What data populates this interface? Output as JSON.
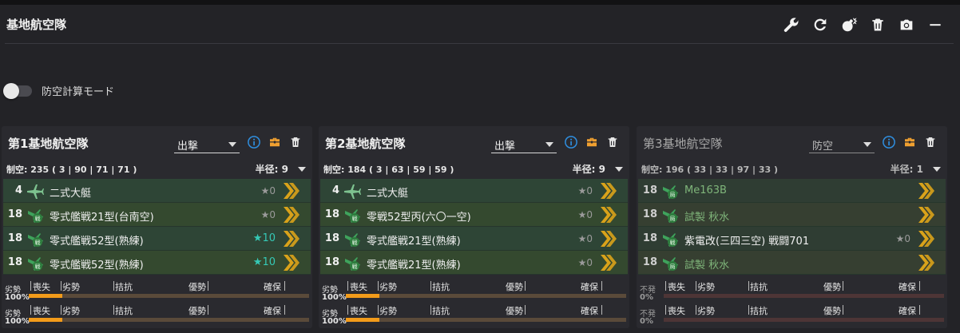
{
  "header": {
    "title": "基地航空隊"
  },
  "icons": {
    "wrench": "wrench-icon",
    "reload": "reload-icon",
    "bomb": "bomb-icon",
    "trash": "trash-icon",
    "camera": "camera-icon",
    "minimize": "minimize-icon"
  },
  "toggle": {
    "label": "防空計算モード",
    "on": false
  },
  "colors": {
    "accent_info": "#2f8fe0",
    "accent_orange": "#f0a030",
    "bar_fill": "#f29b1a",
    "chevron": "#d9a21a",
    "star_teal": "#35c9b6",
    "plane_green": "#3fa35c"
  },
  "corps": [
    {
      "name": "第1基地航空隊",
      "mode": "出撃",
      "air": "制空: 235 ( 3 | 90 | 71 | 71 )",
      "radius": "半径: 9",
      "slots": [
        {
          "count": "4",
          "name": "二式大艇",
          "prof": "★0",
          "prof_teal": false,
          "green": false,
          "icon": "flying-boat-icon"
        },
        {
          "count": "18",
          "name": "零式艦戦21型(台南空)",
          "prof": "★0",
          "prof_teal": false,
          "green": false,
          "icon": "fighter-icon"
        },
        {
          "count": "18",
          "name": "零式艦戦52型(熟練)",
          "prof": "★10",
          "prof_teal": true,
          "green": false,
          "icon": "fighter-icon"
        },
        {
          "count": "18",
          "name": "零式艦戦52型(熟練)",
          "prof": "★10",
          "prof_teal": true,
          "green": false,
          "icon": "fighter-icon"
        }
      ],
      "bars": [
        {
          "state": "劣勢",
          "pct": "100%",
          "fill": 0.12
        },
        {
          "state": "劣勢",
          "pct": "100%",
          "fill": 0.12
        }
      ]
    },
    {
      "name": "第2基地航空隊",
      "mode": "出撃",
      "air": "制空: 184 ( 3 | 63 | 59 | 59 )",
      "radius": "半径: 9",
      "slots": [
        {
          "count": "4",
          "name": "二式大艇",
          "prof": "★0",
          "prof_teal": false,
          "green": false,
          "icon": "flying-boat-icon"
        },
        {
          "count": "18",
          "name": "零戦52型丙(六〇一空)",
          "prof": "★0",
          "prof_teal": false,
          "green": false,
          "icon": "fighter-icon"
        },
        {
          "count": "18",
          "name": "零式艦戦21型(熟練)",
          "prof": "★0",
          "prof_teal": false,
          "green": false,
          "icon": "fighter-icon"
        },
        {
          "count": "18",
          "name": "零式艦戦21型(熟練)",
          "prof": "★0",
          "prof_teal": false,
          "green": false,
          "icon": "fighter-icon"
        }
      ],
      "bars": [
        {
          "state": "劣勢",
          "pct": "100%",
          "fill": 0.12
        },
        {
          "state": "劣勢",
          "pct": "100%",
          "fill": 0.12
        }
      ]
    },
    {
      "name": "第3基地航空隊",
      "mode": "防空",
      "air": "制空: 196 ( 33 | 33 | 97 | 33 )",
      "radius": "半径: 1",
      "slots": [
        {
          "count": "18",
          "name": "Me163B",
          "prof": "",
          "prof_teal": false,
          "green": true,
          "icon": "interceptor-icon"
        },
        {
          "count": "18",
          "name": "試製 秋水",
          "prof": "",
          "prof_teal": false,
          "green": true,
          "icon": "interceptor-icon"
        },
        {
          "count": "18",
          "name": "紫電改(三四三空) 戦闘701",
          "prof": "★0",
          "prof_teal": false,
          "green": false,
          "icon": "fighter-icon"
        },
        {
          "count": "18",
          "name": "試製 秋水",
          "prof": "",
          "prof_teal": false,
          "green": true,
          "icon": "interceptor-icon"
        }
      ],
      "bars": [
        {
          "state": "不発",
          "pct": "0%",
          "fill": 0
        },
        {
          "state": "不発",
          "pct": "0%",
          "fill": 0
        }
      ]
    }
  ],
  "scale": {
    "lost": "喪失",
    "inferior": "劣勢",
    "parity": "拮抗",
    "superior": "優勢",
    "secured": "確保"
  }
}
